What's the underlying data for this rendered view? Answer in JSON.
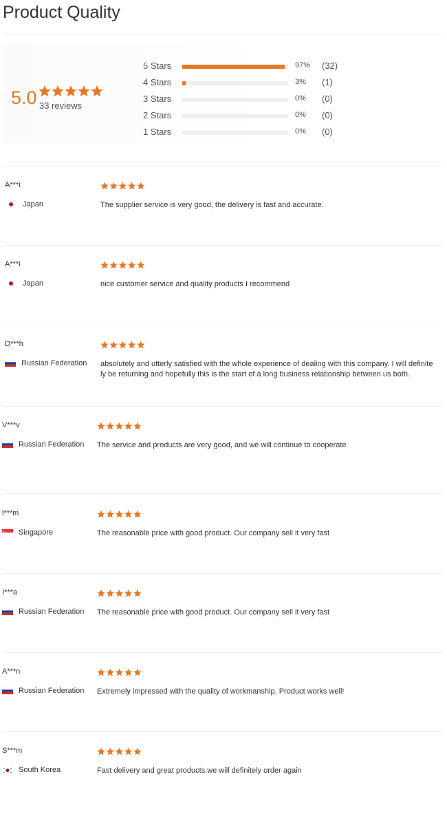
{
  "page": {
    "title": "Product Quality"
  },
  "summary": {
    "score": "5.0",
    "review_count_label": "33 reviews",
    "accent_color": "#e87722",
    "rows": [
      {
        "label": "5 Stars",
        "percent": 97,
        "percent_label": "97%",
        "count_label": "(32)"
      },
      {
        "label": "4 Stars",
        "percent": 3,
        "percent_label": "3%",
        "count_label": "(1)"
      },
      {
        "label": "3 Stars",
        "percent": 0,
        "percent_label": "0%",
        "count_label": "(0)"
      },
      {
        "label": "2 Stars",
        "percent": 0,
        "percent_label": "0%",
        "count_label": "(0)"
      },
      {
        "label": "1 Stars",
        "percent": 0,
        "percent_label": "0%",
        "count_label": "(0)"
      }
    ]
  },
  "reviews": [
    {
      "name": "A***i",
      "country": "Japan",
      "flag": "japan-flag-icon",
      "rating": 5,
      "lines": [
        "The supplier service is very good, the delivery is fast and accurate."
      ]
    },
    {
      "name": "A***i",
      "country": "Japan",
      "flag": "japan-flag-icon",
      "rating": 5,
      "lines": [
        "nice customer service and quality products I recommend"
      ]
    },
    {
      "name": "D***h",
      "country": "Russian Federation",
      "flag": "russia-flag-icon",
      "rating": 5,
      "lines": [
        "absolutely and utterly satisfied with the whole experience of dealing with this company. I will definite",
        "ly be returning and hopefully this is the start of a long business relationship between us both."
      ]
    },
    {
      "name": "V***v",
      "country": "Russian Federation",
      "flag": "russia-flag-icon",
      "rating": 5,
      "lines": [
        "The service and products are very good, and we will continue to cooperate"
      ]
    },
    {
      "name": "l***m",
      "country": "Singapore",
      "flag": "singapore-flag-icon",
      "rating": 5,
      "lines": [
        "The reasonable price with good product. Our company sell it very fast"
      ]
    },
    {
      "name": "I***a",
      "country": "Russian Federation",
      "flag": "russia-flag-icon",
      "rating": 5,
      "lines": [
        "The reasonable price with good product. Our company sell it very fast"
      ]
    },
    {
      "name": "A***n",
      "country": "Russian Federation",
      "flag": "russia-flag-icon",
      "rating": 5,
      "lines": [
        "Extremely impressed with the quality of workmanship. Product works well!"
      ]
    },
    {
      "name": "S***m",
      "country": "South Korea",
      "flag": "south-korea-flag-icon",
      "rating": 5,
      "lines": [
        "Fast delivery and great products,we will definitely order again"
      ]
    }
  ]
}
